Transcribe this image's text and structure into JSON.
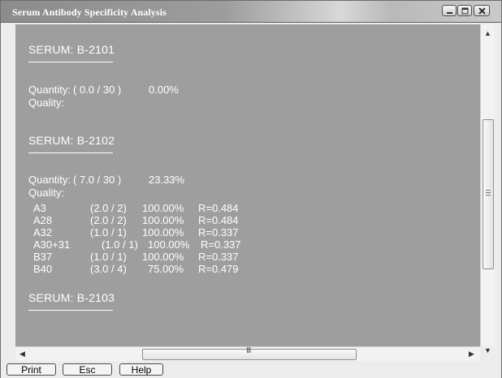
{
  "window": {
    "title": "Serum Antibody Specificity Analysis"
  },
  "serums": [
    {
      "heading": "SERUM:  B-2101",
      "quantity_label": "Quantity:",
      "quantity_value": "( 0.0 / 30 )",
      "quantity_percent": "0.00%",
      "quality_label": "Quality:",
      "rows": []
    },
    {
      "heading": "SERUM:  B-2102",
      "quantity_label": "Quantity:",
      "quantity_value": "( 7.0 / 30 )",
      "quantity_percent": "23.33%",
      "quality_label": "Quality:",
      "rows": [
        {
          "antigen": "A3",
          "ratio": "(2.0 / 2)",
          "percent": "100.00%",
          "r": "R=0.484"
        },
        {
          "antigen": "A28",
          "ratio": "(2.0 / 2)",
          "percent": "100.00%",
          "r": "R=0.484"
        },
        {
          "antigen": "A32",
          "ratio": "(1.0 / 1)",
          "percent": "100.00%",
          "r": "R=0.337"
        },
        {
          "antigen": "A30+31",
          "ratio": "(1.0 / 1)",
          "percent": "100.00%",
          "r": "R=0.337"
        },
        {
          "antigen": "B37",
          "ratio": "(1.0 / 1)",
          "percent": "100.00%",
          "r": "R=0.337"
        },
        {
          "antigen": "B40",
          "ratio": "(3.0 / 4)",
          "percent": "75.00%",
          "r": "R=0.479"
        }
      ]
    },
    {
      "heading": "SERUM:  B-2103"
    }
  ],
  "buttons": {
    "print": "Print",
    "esc": "Esc",
    "help": "Help"
  },
  "scrollbar": {
    "h_grip": "III",
    "v_grip_lines": 3
  }
}
